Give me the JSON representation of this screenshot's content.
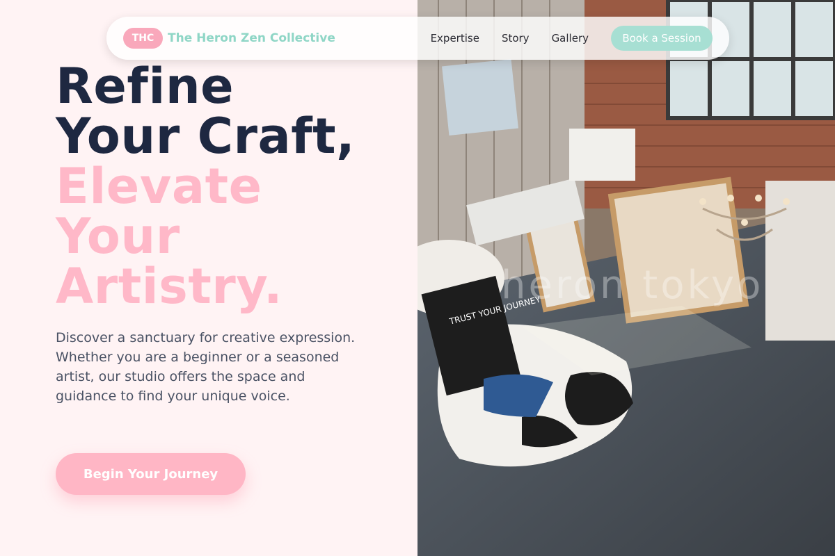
{
  "nav": {
    "badge": "THC",
    "brand": "The Heron Zen Collective",
    "links": [
      "Expertise",
      "Story",
      "Gallery"
    ],
    "cta": "Book a Session"
  },
  "hero": {
    "line1": "Refine",
    "line2": "Your Craft,",
    "line3": "Elevate",
    "line4": "Your",
    "line5": "Artistry.",
    "description": "Discover a sanctuary for creative expression. Whether you are a beginner or a seasoned artist, our studio offers the space and guidance to find your unique voice.",
    "cta": "Begin Your Journey"
  },
  "photo": {
    "watermark": "heron tokyo",
    "sign": "TRUST YOUR JOURNEY"
  },
  "colors": {
    "brand_pink": "#ffb8c8",
    "brand_mint": "#a7dfd3",
    "heading_dark": "#1e2841"
  }
}
